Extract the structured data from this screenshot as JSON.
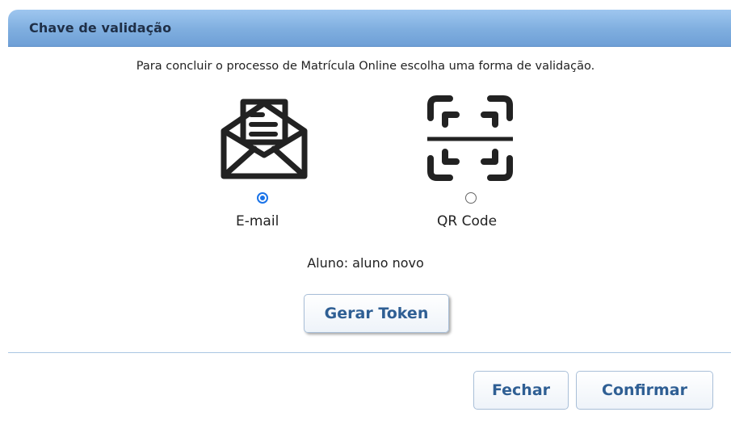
{
  "dialog": {
    "title": "Chave de validação",
    "instruction": "Para concluir o processo de Matrícula Online escolha uma forma de validação.",
    "options": [
      {
        "label": "E-mail",
        "icon": "envelope-icon",
        "selected": true
      },
      {
        "label": "QR Code",
        "icon": "qr-scan-icon",
        "selected": false
      }
    ],
    "student": "Aluno: aluno novo",
    "generate_token_label": "Gerar Token",
    "close_label": "Fechar",
    "confirm_label": "Confirmar"
  },
  "colors": {
    "header_top": "#9ec6ef",
    "header_bottom": "#6e9fd6",
    "button_text": "#2f5f94",
    "radio_accent": "#1a73e8",
    "divider": "#a9c6e3"
  }
}
